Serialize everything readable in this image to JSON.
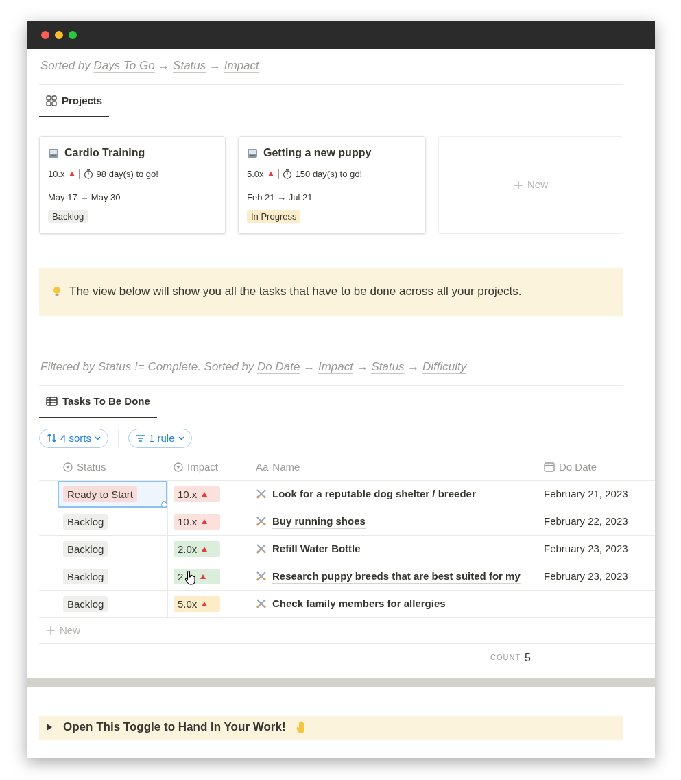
{
  "window": {
    "controls": [
      {
        "color": "#ff5f57"
      },
      {
        "color": "#febc2e"
      },
      {
        "color": "#28c840"
      }
    ]
  },
  "projects_view": {
    "sort_note": {
      "prefix": "Sorted by",
      "keys": [
        "Days To Go",
        "Status",
        "Impact"
      ],
      "separator": "→"
    },
    "tab": {
      "label": "Projects",
      "selected": true
    },
    "cards": [
      {
        "title": "Cardio Training",
        "impact": "10.x",
        "days": "98 day(s) to go!",
        "dates": "May 17 → May 30",
        "status": {
          "label": "Backlog",
          "color": "#eeeeec"
        }
      },
      {
        "title": "Getting a new puppy",
        "impact": "5.0x",
        "days": "150 day(s) to go!",
        "dates": "Feb 21 → Jul 21",
        "status": {
          "label": "In Progress",
          "color": "#fbedc9"
        }
      }
    ],
    "new_card": "New"
  },
  "callout": {
    "text": "The view below will show you all the tasks that have to be done across all your projects."
  },
  "tasks_view": {
    "filter_note": {
      "prefix": "Filtered by Status != Complete. Sorted by",
      "keys": [
        "Do Date",
        "Impact",
        "Status",
        "Difficulty"
      ],
      "separator": "→"
    },
    "tab": {
      "label": "Tasks To Be Done",
      "selected": true
    },
    "buttons": [
      {
        "kind": "sort",
        "label": "4 sorts"
      },
      {
        "kind": "filter",
        "label": "1 rule"
      }
    ],
    "table": {
      "columns": [
        {
          "kind": "select",
          "label": "Status"
        },
        {
          "kind": "select",
          "label": "Impact"
        },
        {
          "kind": "title",
          "type_label": "Aa",
          "label": "Name"
        },
        {
          "kind": "date",
          "label": "Do Date"
        }
      ],
      "rows": [
        {
          "selected": true,
          "status": {
            "label": "Ready to Start",
            "color": "#f7dcd9"
          },
          "impact": {
            "label": "10.x",
            "color": "#fbe0dc"
          },
          "name": "Look for a reputable dog shelter / breeder",
          "date": "February 21, 2023"
        },
        {
          "selected": false,
          "status": {
            "label": "Backlog",
            "color": "#eeeeec"
          },
          "impact": {
            "label": "10.x",
            "color": "#fbe0dc"
          },
          "name": "Buy running shoes",
          "date": "February 22, 2023"
        },
        {
          "selected": false,
          "status": {
            "label": "Backlog",
            "color": "#eeeeec"
          },
          "impact": {
            "label": "2.0x",
            "color": "#dbeddb"
          },
          "name": "Refill Water Bottle",
          "date": "February 23, 2023"
        },
        {
          "selected": false,
          "status": {
            "label": "Backlog",
            "color": "#eeeeec"
          },
          "impact": {
            "label": "2",
            "color": "#dbeddb",
            "cursor": true
          },
          "name": "Research puppy breeds that are best suited for my",
          "date": "February 23, 2023"
        },
        {
          "selected": false,
          "status": {
            "label": "Backlog",
            "color": "#eeeeec"
          },
          "impact": {
            "label": "5.0x",
            "color": "#fdecc8"
          },
          "name": "Check family members for allergies"
        }
      ],
      "new_row": "New",
      "count": {
        "label": "COUNT",
        "value": "5"
      }
    }
  },
  "toggle": {
    "label": "Open This Toggle to Hand In Your Work!",
    "expanded": false
  }
}
